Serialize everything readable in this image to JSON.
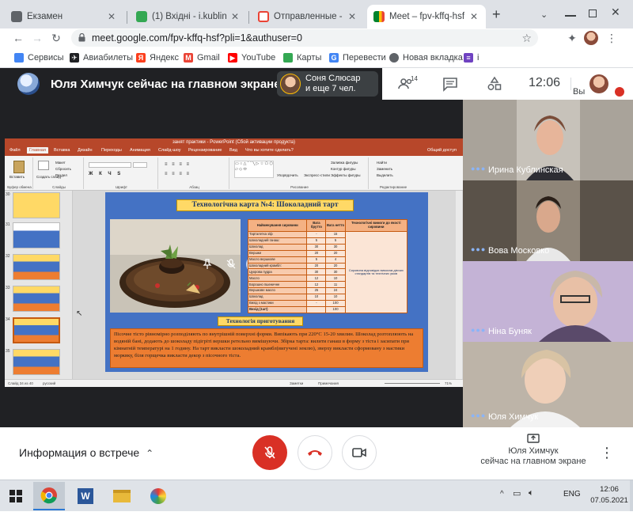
{
  "browser": {
    "tabs": [
      {
        "title": "Екзамен",
        "color": "#5f6368"
      },
      {
        "title": "(1) Вхідні - i.kublinska@",
        "color": "#34a853"
      },
      {
        "title": "Отправленные - ilonka",
        "color": "#ea4335"
      },
      {
        "title": "Meet – fpv-kffq-hsf",
        "color": "#00832d"
      }
    ],
    "new_tab": "+",
    "url": "meet.google.com/fpv-kffq-hsf?pli=1&authuser=0"
  },
  "bookmarks": [
    {
      "label": "Сервисы",
      "color": "#4285f4",
      "icon": "apps-grid-icon"
    },
    {
      "label": "Авиабилеты",
      "color": "#202124",
      "icon": "plane-icon"
    },
    {
      "label": "Яндекс",
      "color": "#fc3f1d",
      "icon": "yandex-icon"
    },
    {
      "label": "Gmail",
      "color": "#ea4335",
      "icon": "gmail-icon"
    },
    {
      "label": "YouTube",
      "color": "#ff0000",
      "icon": "youtube-icon"
    },
    {
      "label": "Карты",
      "color": "#34a853",
      "icon": "maps-icon"
    },
    {
      "label": "Перевести",
      "color": "#4285f4",
      "icon": "translate-icon"
    },
    {
      "label": "Новая вкладка",
      "color": "#5f6368",
      "icon": "globe-icon"
    },
    {
      "label": "i",
      "color": "#6f42c1",
      "icon": "bookmark-icon"
    }
  ],
  "meet": {
    "presenter_banner": "Юля Химчук сейчас на главном экране",
    "others_line1": "Соня Слюсар",
    "others_line2": "и еще 7 чел.",
    "participants_count": "14",
    "clock": "12:06",
    "self_label": "Вы",
    "participants": [
      {
        "name": "Ирина Кублинская"
      },
      {
        "name": "Вова Московко"
      },
      {
        "name": "Ніна Буняк"
      },
      {
        "name": "Юля Химчук"
      }
    ],
    "meeting_info": "Информация о встрече",
    "presenting_line1": "Юля Химчук",
    "presenting_line2": "сейчас на главном экране"
  },
  "ppt": {
    "window_title": "занят практики - PowerPoint (Сбой активации продукта)",
    "menu": [
      "Файл",
      "Главная",
      "Вставка",
      "Дизайн",
      "Переходы",
      "Анимация",
      "Слайд-шоу",
      "Рецензирование",
      "Вид",
      "Что вы хотите сделать?"
    ],
    "share": "Общий доступ",
    "ribbon_groups": [
      "Буфер обмена",
      "Слайды",
      "Шрифт",
      "Абзац",
      "Рисование",
      "Редактирование"
    ],
    "ribbon_items": [
      "Вставить",
      "Создать слайд",
      "Макет",
      "Сбросить",
      "Раздел",
      "Упорядочить",
      "Экспресс-стили",
      "Заливка фигуры",
      "Контур фигуры",
      "Эффекты фигуры",
      "Найти",
      "Заменить",
      "Выделить"
    ],
    "thumb_numbers": [
      "30",
      "31",
      "32",
      "33",
      "34",
      "35"
    ],
    "status_left": "Слайд 34 из 40",
    "status_lang": "русский",
    "status_notes": "Заметки",
    "status_comments": "Примечания",
    "zoom": "71%"
  },
  "slide": {
    "title": "Технологічна карта №4: Шоколадний тарт",
    "table_headers": [
      "Найменування сировини",
      "Вага брутто",
      "Вага нетто",
      "Технологічні вимоги до якості сировини"
    ],
    "rows": [
      [
        "Тарталетка з/ф",
        "-",
        "15"
      ],
      [
        "Шоколадний ганаш:",
        "5",
        "5"
      ],
      [
        "Шоколад",
        "30",
        "30"
      ],
      [
        "Вершки",
        "20",
        "20"
      ],
      [
        "Масло вершкове",
        "5",
        "4"
      ],
      [
        "Шоколадний крамбл:",
        "20",
        "20"
      ],
      [
        "Цукрова пудра",
        "30",
        "30"
      ],
      [
        "Масло",
        "12",
        "10"
      ],
      [
        "Борошно пшеничне",
        "12",
        "11"
      ],
      [
        "Вершкове масло",
        "25",
        "24"
      ],
      [
        "Шоколад",
        "10",
        "10"
      ],
      [
        "Вихід з мастики",
        "-",
        "100"
      ]
    ],
    "yield_label": "Вихід (1шт)",
    "yield_value": "100",
    "requirements": "Сировина відповідає вимогам діючих стандартів та технічних умов",
    "subtitle": "Технологія приготування",
    "text": "Пісочне тісто рівномірно розподіляють по внутрішній поверхні форми. Випікають при 220°С 15-20 хвилин. Шоколад розтоплюють на водяній бані, додають до шоколаду підігріті вершки ретельно вимішуючи. Збірка тарта: вилити ганаш в форму з тіста і засипати при кімнатній температурі на 1 годину. На тарт викласти шоколадний крамбл(вигучені землю), зверху викласти сформовану з мастики морквку, біля горщечка викласти декор з пісочного тіста."
  },
  "taskbar": {
    "lang": "ENG",
    "time": "12:06",
    "date": "07.05.2021"
  }
}
